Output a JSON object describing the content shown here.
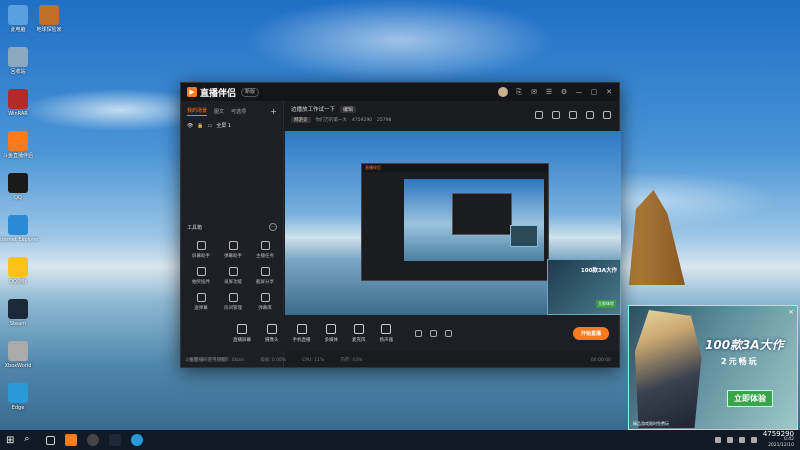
{
  "desktop": {
    "icons": [
      {
        "label": "此电脑",
        "color": "#5aa0e0"
      },
      {
        "label": "回收站",
        "color": "#8aa9c0"
      },
      {
        "label": "WinRAR",
        "color": "#b22a2a"
      },
      {
        "label": "斗鱼直播伴侣",
        "color": "#ff7a1a"
      },
      {
        "label": "QQ",
        "color": "#1a1a1a"
      },
      {
        "label": "Internet Explorer",
        "color": "#2a8ad6"
      },
      {
        "label": "QQ游戏",
        "color": "#ffc21a"
      },
      {
        "label": "Steam",
        "color": "#1b2838"
      },
      {
        "label": "XboxWorld",
        "color": "#aaaaaa"
      },
      {
        "label": "Edge",
        "color": "#2a9ad6"
      }
    ],
    "icon_col2": {
      "label": "地球探险家",
      "color": "#c0702a"
    }
  },
  "window": {
    "app_name": "直播伴侣",
    "version_badge": "新版",
    "title_buttons": [
      "⎘",
      "✉",
      "☰",
      "⚙",
      "—",
      "▢",
      "✕"
    ],
    "sidebar": {
      "tabs": [
        "我的场景",
        "图文",
        "可选项"
      ],
      "active_tab": 0,
      "scene_label": "全屏 1",
      "tools_title": "工具箱",
      "tools": [
        "屏幕助手",
        "弹幕助手",
        "主播任务",
        "抽奖插件",
        "录屏功能",
        "截屏分享",
        "送弹幕",
        "房间管理",
        "弹幕库",
        "上墙",
        "",
        ""
      ],
      "footer": "斗鱼直播间使用教程"
    },
    "room": {
      "title": "边播放工作试一下",
      "edit": "编辑",
      "category": "网游竞",
      "subtitle": "你们万的第一大",
      "viewers": "4759290",
      "fans": "25798"
    },
    "preview_ad": {
      "title": "100款3A大作",
      "button": "立即体验"
    },
    "controls": [
      {
        "label": "直播屏幕"
      },
      {
        "label": "摄像头"
      },
      {
        "label": "手机直播"
      },
      {
        "label": "多媒体"
      },
      {
        "label": "麦克风"
      },
      {
        "label": "扬声器"
      }
    ],
    "live_button": "开始直播",
    "status": {
      "items": [
        "帧率: 0",
        "码率: 0kb/s",
        "丢帧: 0.00%",
        "CPU: 11%",
        "内存: 43%"
      ],
      "time": "00:00:00"
    }
  },
  "ad": {
    "title": "100款3A大作",
    "subtitle": "2元畅玩",
    "cta": "立即体验",
    "close": "×",
    "footer": "精品游戏限时免费玩"
  },
  "taskbar": {
    "clock_big": "4759290",
    "clock_time": "0:42",
    "clock_date": "2021/12/10"
  }
}
